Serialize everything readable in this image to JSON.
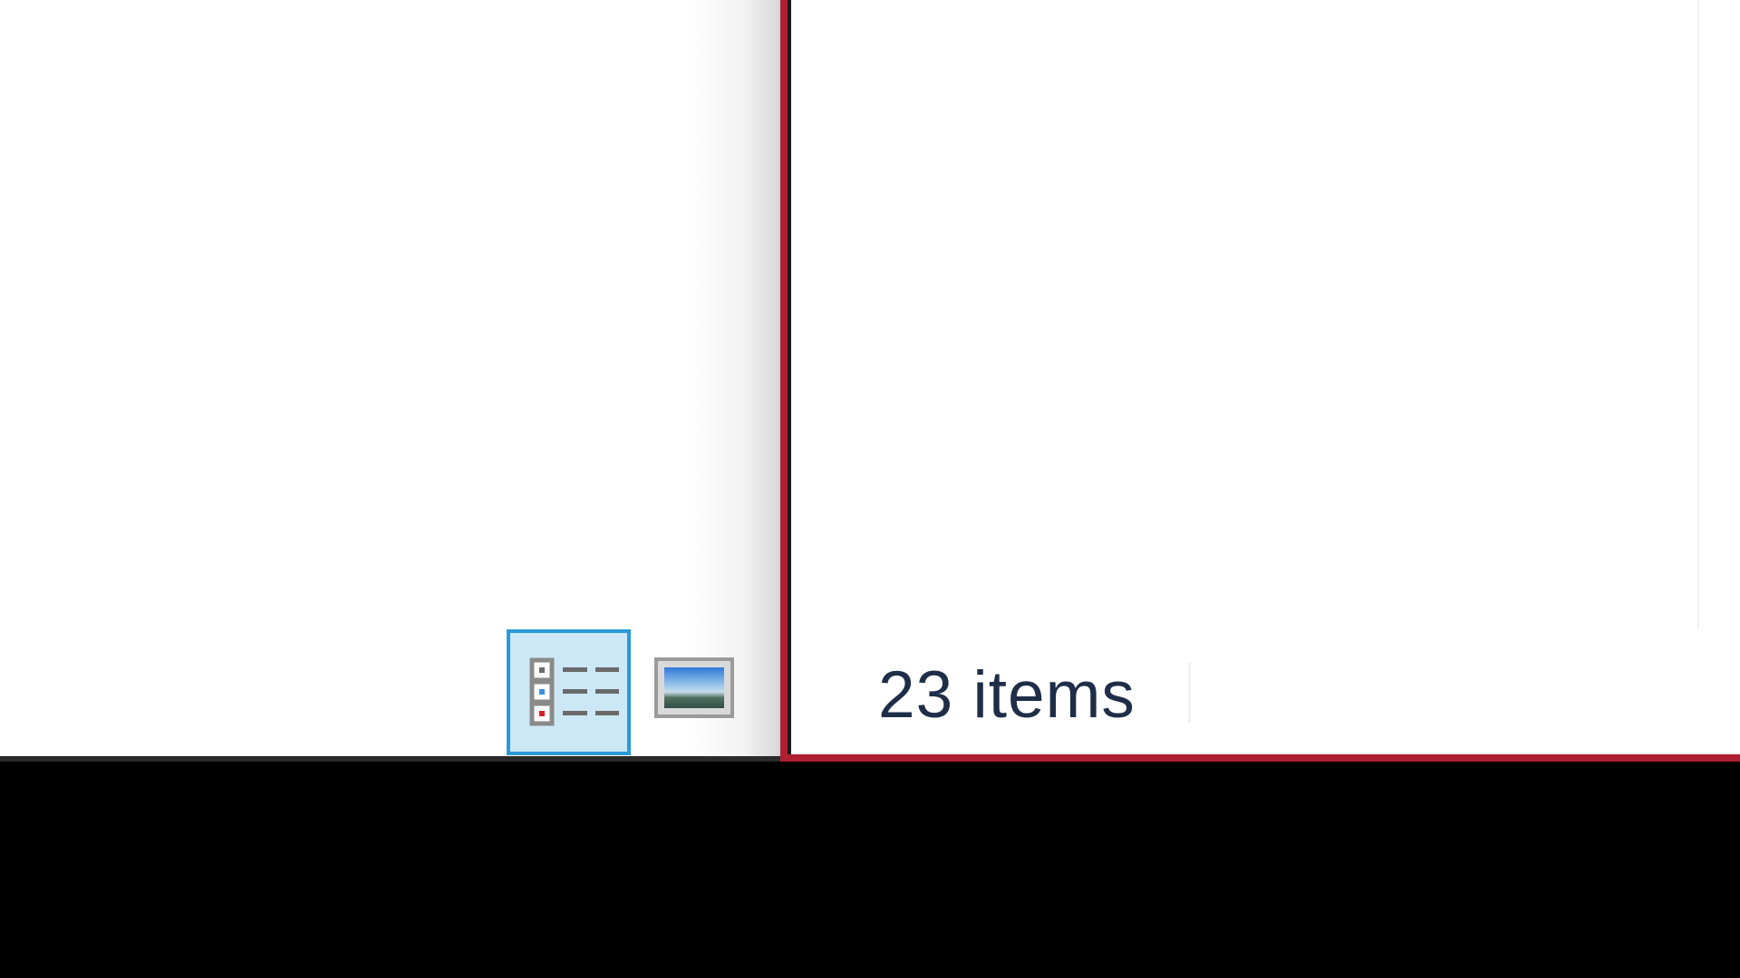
{
  "status_bar": {
    "item_count": "23 items"
  },
  "view_buttons": {
    "details": {
      "icon": "details-view-icon",
      "selected": true
    },
    "large_icons": {
      "icon": "large-icons-view-icon",
      "selected": false
    }
  },
  "colors": {
    "active_window_border": "#b01e32",
    "selected_button_bg": "#cce8f6",
    "selected_button_border": "#2a9ad8",
    "status_text": "#1e2e48",
    "taskbar": "#000000"
  }
}
